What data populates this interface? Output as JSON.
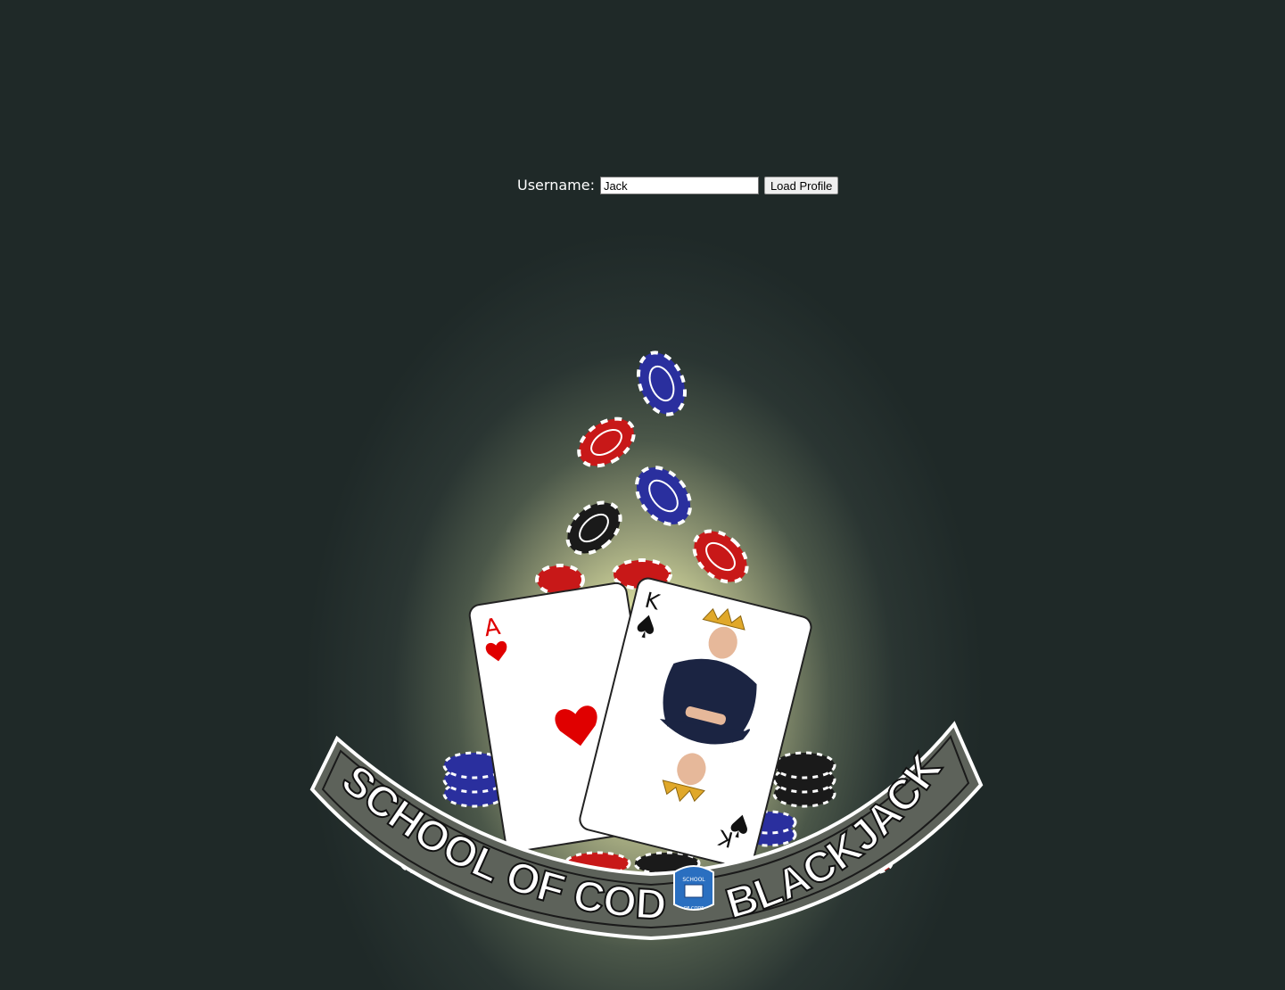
{
  "login": {
    "label": "Username:",
    "value": "Jack",
    "button_label": "Load Profile"
  },
  "logo": {
    "text_left": "SCHOOL OF CODE",
    "text_right": "BLACKJACK",
    "badge_text_top": "SCHOOL",
    "badge_text_bottom": "OF CODE",
    "ace_rank": "A",
    "king_rank": "K"
  },
  "colors": {
    "background": "#1f2928",
    "glow": "#f6f7c4",
    "chip_red": "#c81818",
    "chip_blue": "#2a2f9e",
    "chip_black": "#1a1a1a",
    "heart": "#e00000"
  }
}
